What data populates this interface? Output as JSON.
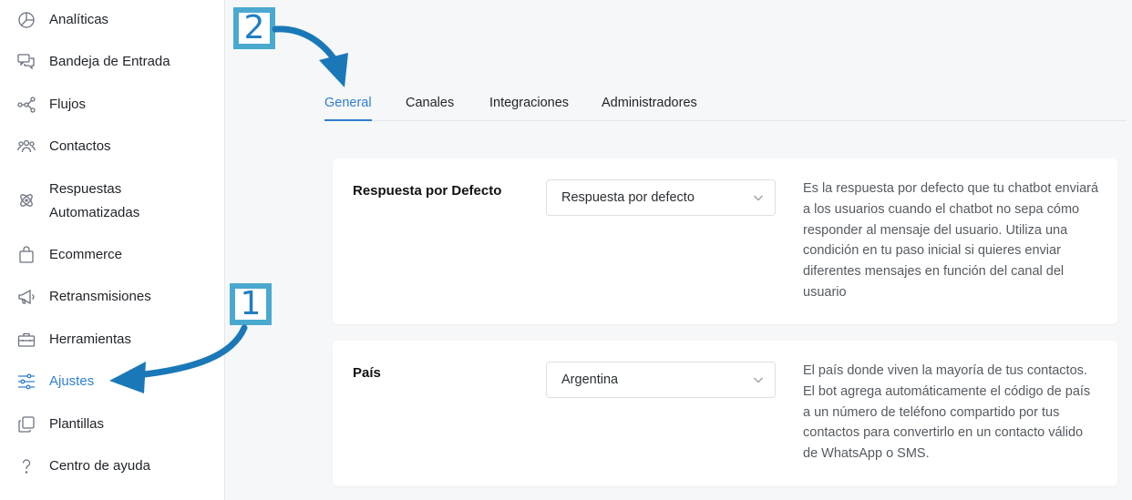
{
  "sidebar": {
    "items": [
      {
        "label": "Analíticas",
        "icon": "pie-chart-icon"
      },
      {
        "label": "Bandeja de Entrada",
        "icon": "chat-bubbles-icon"
      },
      {
        "label": "Flujos",
        "icon": "flow-nodes-icon"
      },
      {
        "label": "Contactos",
        "icon": "people-icon"
      },
      {
        "label": "Respuestas Automatizadas",
        "label_line1": "Respuestas",
        "label_line2": "Automatizadas",
        "icon": "atom-icon"
      },
      {
        "label": "Ecommerce",
        "icon": "shopping-bag-icon"
      },
      {
        "label": "Retransmisiones",
        "icon": "megaphone-icon"
      },
      {
        "label": "Herramientas",
        "icon": "toolbox-icon"
      },
      {
        "label": "Ajustes",
        "icon": "sliders-icon",
        "active": true
      },
      {
        "label": "Plantillas",
        "icon": "copy-icon"
      },
      {
        "label": "Centro de ayuda",
        "icon": "question-icon"
      }
    ]
  },
  "tabs": [
    {
      "label": "General",
      "active": true
    },
    {
      "label": "Canales"
    },
    {
      "label": "Integraciones"
    },
    {
      "label": "Administradores"
    }
  ],
  "settings": {
    "default_response": {
      "title": "Respuesta por Defecto",
      "selected": "Respuesta por defecto",
      "description": "Es la respuesta por defecto que tu chatbot enviará a los usuarios cuando el chatbot no sepa cómo responder al mensaje del usuario. Utiliza una condición en tu paso inicial si quieres enviar diferentes mensajes en función del canal del usuario"
    },
    "country": {
      "title": "País",
      "selected": "Argentina",
      "description": "El país donde viven la mayoría de tus contactos. El bot agrega automáticamente el código de país a un número de teléfono compartido por tus contactos para convertirlo en un contacto válido de WhatsApp o SMS."
    }
  },
  "callouts": {
    "step1": "1",
    "step2": "2"
  },
  "colors": {
    "accent": "#2f7fd0",
    "callout_border": "#4aa9cf",
    "arrow": "#1a78b8"
  }
}
